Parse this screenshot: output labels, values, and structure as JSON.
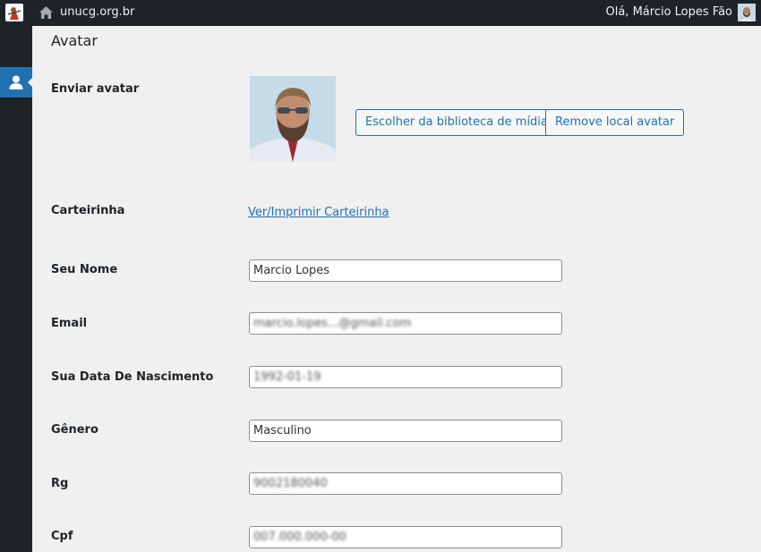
{
  "adminbar": {
    "site_name": "unucg.org.br",
    "greeting": "Olá, Márcio Lopes Fão",
    "icons": [
      "site-logo-icon",
      "home-icon",
      "user-avatar-icon"
    ]
  },
  "sidemenu": {
    "active_icon": "users-icon"
  },
  "section": {
    "title": "Avatar"
  },
  "avatar": {
    "label": "Enviar avatar",
    "choose_label": "Escolher da biblioteca de mídia",
    "remove_label": "Remove local avatar"
  },
  "card": {
    "label": "Carteirinha",
    "link_text": "Ver/Imprimir Carteirinha"
  },
  "fields": {
    "name": {
      "label": "Seu Nome",
      "value": "Marcio Lopes"
    },
    "email": {
      "label": "Email",
      "value": "marcio.lopes...@gmail.com"
    },
    "birth": {
      "label": "Sua Data De Nascimento",
      "value": "1992-01-19"
    },
    "gender": {
      "label": "Gênero",
      "value": "Masculino"
    },
    "rg": {
      "label": "Rg",
      "value": "9002180040"
    },
    "cpf": {
      "label": "Cpf",
      "value": "007.000.000-00"
    }
  },
  "colors": {
    "accent": "#2271b1",
    "adminbar_bg": "#1d2327",
    "page_bg": "#f0f0f1"
  }
}
